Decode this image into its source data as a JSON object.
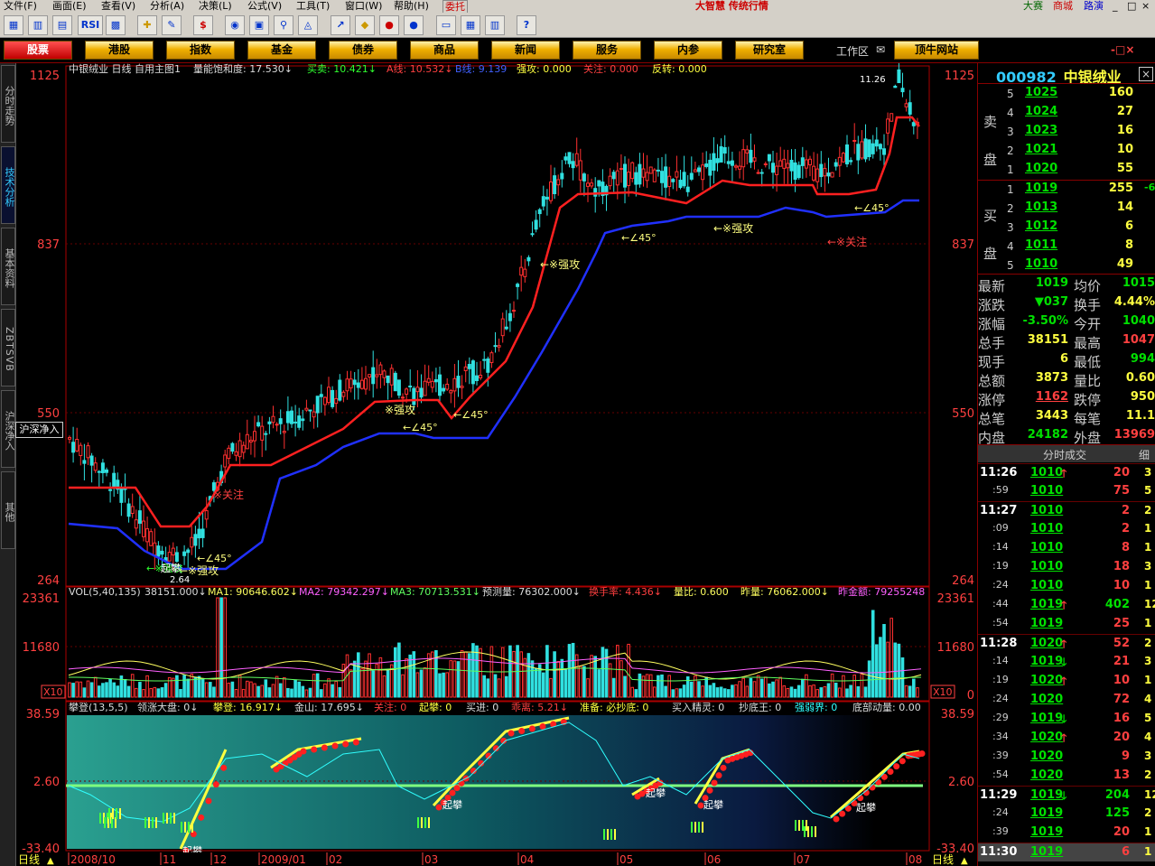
{
  "menu": [
    "文件(F)",
    "画面(E)",
    "查看(V)",
    "分析(A)",
    "决策(L)",
    "公式(V)",
    "工具(T)",
    "窗口(W)",
    "帮助(H)",
    "委托"
  ],
  "brand": "大智慧 传统行情",
  "top_links": [
    "大赛",
    "商城",
    "路演"
  ],
  "toolbar": {
    "rsi": "RSI",
    "s": "$"
  },
  "nav": [
    "股票",
    "港股",
    "指数",
    "基金",
    "债券",
    "商品",
    "新闻",
    "服务",
    "内参",
    "研究室"
  ],
  "workspace": "工作区",
  "site": "顶牛网站",
  "left_tabs": [
    "分时走势",
    "技术分析",
    "基本资料",
    "ZBTSVB",
    "沪深净入",
    "其他"
  ],
  "tooltip": "沪深净入",
  "main": {
    "header": "中银绒业 日线 自用主图1",
    "ind_text": [
      "量能饱和度: 17.530↓",
      "买卖: 10.421↓",
      "A线: 10.532↓",
      "B线: 9.139",
      "强攻: 0.000",
      "关注: 0.000",
      "反转: 0.000"
    ],
    "y_labels": [
      "1125",
      "837",
      "550",
      "264"
    ],
    "price_note": "11.26",
    "annotations": [
      "←※强攻",
      "←∠45°",
      "←※强攻",
      "※关注",
      "←※关注",
      "←∠45°",
      "←※强攻",
      "※强攻",
      "←∠45°",
      "←∠45°",
      "←∠45°",
      "2.64",
      "←※强攻"
    ]
  },
  "volume": {
    "header": [
      "VOL(5,40,135)",
      "38151.000↓",
      "MA1: 90646.602↓",
      "MA2: 79342.297↓",
      "MA3: 70713.531↓",
      "预测量: 76302.000↓",
      "换手率: 4.436↓",
      "量比: 0.600",
      "昨量: 76062.000↓",
      "昨金额: 79255248"
    ],
    "y_labels": [
      "23361",
      "11680",
      "0"
    ],
    "unit": "X10"
  },
  "indicator": {
    "header": [
      "攀登(13,5,5)",
      "领涨大盘: 0↓",
      "攀登: 16.917↓",
      "金山: 17.695↓",
      "关注: 0",
      "起攀: 0",
      "买进: 0",
      "乖离: 5.21↓",
      "准备: 必抄底: 0",
      "买入精灵: 0",
      "抄底王: 0",
      "强弱界: 0",
      "底部动量: 0.00"
    ],
    "y_labels": [
      "38.59",
      "2.60",
      "-33.40"
    ],
    "labels": [
      "起攀",
      "起攀",
      "起攀",
      "起攀",
      "起攀",
      "起攀"
    ]
  },
  "timeline": {
    "mode": "日线",
    "dates": [
      "2008/10",
      "11",
      "12",
      "2009/01",
      "02",
      "03",
      "04",
      "05",
      "06",
      "07",
      "08"
    ]
  },
  "quote": {
    "code": "000982",
    "name": "中银绒业",
    "sell": [
      {
        "lvl": "5",
        "price": "1025",
        "vol": "160"
      },
      {
        "lvl": "4",
        "price": "1024",
        "vol": "27"
      },
      {
        "lvl": "3",
        "price": "1023",
        "vol": "16"
      },
      {
        "lvl": "2",
        "price": "1021",
        "vol": "10"
      },
      {
        "lvl": "1",
        "price": "1020",
        "vol": "55"
      }
    ],
    "buy": [
      {
        "lvl": "1",
        "price": "1019",
        "vol": "255",
        "extra": "-6"
      },
      {
        "lvl": "2",
        "price": "1013",
        "vol": "14"
      },
      {
        "lvl": "3",
        "price": "1012",
        "vol": "6"
      },
      {
        "lvl": "4",
        "price": "1011",
        "vol": "8"
      },
      {
        "lvl": "5",
        "price": "1010",
        "vol": "49"
      }
    ],
    "sell_label": "卖盘",
    "buy_label": "买盘",
    "stats": [
      [
        "最新",
        "1019",
        "均价",
        "1015"
      ],
      [
        "涨跌",
        "▼037",
        "换手",
        "4.44%"
      ],
      [
        "涨幅",
        "-3.50%",
        "今开",
        "1040"
      ],
      [
        "总手",
        "38151",
        "最高",
        "1047"
      ],
      [
        "现手",
        "6",
        "最低",
        "994"
      ],
      [
        "总额",
        "3873",
        "量比",
        "0.60"
      ],
      [
        "涨停",
        "1162",
        "跌停",
        "950"
      ],
      [
        "总笔",
        "3443",
        "每笔",
        "11.1"
      ],
      [
        "内盘",
        "24182",
        "外盘",
        "13969"
      ]
    ],
    "ticks_title": "分时成交",
    "ticks_tab": "细",
    "ticks": [
      {
        "t": "11:26",
        "p": "1010",
        "arrow": "up",
        "v": "20",
        "n": "3"
      },
      {
        "t": ":59",
        "p": "1010",
        "arrow": "",
        "v": "75",
        "n": "5"
      },
      {
        "t": "11:27",
        "p": "1010",
        "arrow": "",
        "v": "2",
        "n": "2"
      },
      {
        "t": ":09",
        "p": "1010",
        "arrow": "",
        "v": "2",
        "n": "1"
      },
      {
        "t": ":14",
        "p": "1010",
        "arrow": "",
        "v": "8",
        "n": "1"
      },
      {
        "t": ":19",
        "p": "1010",
        "arrow": "",
        "v": "18",
        "n": "3"
      },
      {
        "t": ":24",
        "p": "1010",
        "arrow": "",
        "v": "10",
        "n": "1"
      },
      {
        "t": ":44",
        "p": "1019",
        "arrow": "up",
        "v": "402",
        "n": "12"
      },
      {
        "t": ":54",
        "p": "1019",
        "arrow": "",
        "v": "25",
        "n": "1"
      },
      {
        "t": "11:28",
        "p": "1020",
        "arrow": "up",
        "v": "52",
        "n": "2"
      },
      {
        "t": ":14",
        "p": "1019",
        "arrow": "down",
        "v": "21",
        "n": "3"
      },
      {
        "t": ":19",
        "p": "1020",
        "arrow": "up",
        "v": "10",
        "n": "1"
      },
      {
        "t": ":24",
        "p": "1020",
        "arrow": "",
        "v": "72",
        "n": "4"
      },
      {
        "t": ":29",
        "p": "1019",
        "arrow": "down",
        "v": "16",
        "n": "5"
      },
      {
        "t": ":34",
        "p": "1020",
        "arrow": "up",
        "v": "20",
        "n": "4"
      },
      {
        "t": ":39",
        "p": "1020",
        "arrow": "",
        "v": "9",
        "n": "3"
      },
      {
        "t": ":54",
        "p": "1020",
        "arrow": "",
        "v": "13",
        "n": "2"
      },
      {
        "t": "11:29",
        "p": "1019",
        "arrow": "down",
        "v": "204",
        "n": "12"
      },
      {
        "t": ":24",
        "p": "1019",
        "arrow": "",
        "v": "125",
        "n": "2"
      },
      {
        "t": ":39",
        "p": "1019",
        "arrow": "",
        "v": "20",
        "n": "1"
      },
      {
        "t": "11:30",
        "p": "1019",
        "arrow": "",
        "v": "6",
        "n": "1"
      }
    ]
  }
}
